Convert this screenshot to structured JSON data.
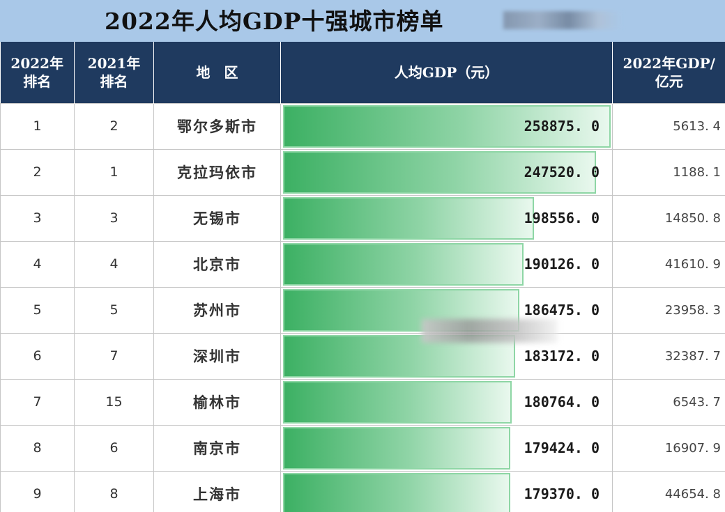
{
  "title": "2022年人均GDP十强城市榜单",
  "headers": {
    "rank_2022": [
      "2022年",
      "排名"
    ],
    "rank_2021": [
      "2021年",
      "排名"
    ],
    "region": "地　区",
    "gdp_per_capita": "人均GDP（元）",
    "gdp_total": [
      "2022年GDP/",
      "亿元"
    ]
  },
  "colors": {
    "header_bg": "#1f3a5f",
    "title_bg": "#a9c8e8",
    "bar_start": "#3cb063",
    "bar_end": "#e9f8ee"
  },
  "chart_data": {
    "type": "table",
    "bar_max": 258875.0,
    "rows": [
      {
        "rank_2022": "1",
        "rank_2021": "2",
        "city": "鄂尔多斯市",
        "gdp_per_capita": 258875.0,
        "gdp_per_capita_text": "258875. 0",
        "gdp_total": "5613. 4"
      },
      {
        "rank_2022": "2",
        "rank_2021": "1",
        "city": "克拉玛依市",
        "gdp_per_capita": 247520.0,
        "gdp_per_capita_text": "247520. 0",
        "gdp_total": "1188. 1"
      },
      {
        "rank_2022": "3",
        "rank_2021": "3",
        "city": "无锡市",
        "gdp_per_capita": 198556.0,
        "gdp_per_capita_text": "198556. 0",
        "gdp_total": "14850. 8"
      },
      {
        "rank_2022": "4",
        "rank_2021": "4",
        "city": "北京市",
        "gdp_per_capita": 190126.0,
        "gdp_per_capita_text": "190126. 0",
        "gdp_total": "41610. 9"
      },
      {
        "rank_2022": "5",
        "rank_2021": "5",
        "city": "苏州市",
        "gdp_per_capita": 186475.0,
        "gdp_per_capita_text": "186475. 0",
        "gdp_total": "23958. 3"
      },
      {
        "rank_2022": "6",
        "rank_2021": "7",
        "city": "深圳市",
        "gdp_per_capita": 183172.0,
        "gdp_per_capita_text": "183172. 0",
        "gdp_total": "32387. 7"
      },
      {
        "rank_2022": "7",
        "rank_2021": "15",
        "city": "榆林市",
        "gdp_per_capita": 180764.0,
        "gdp_per_capita_text": "180764. 0",
        "gdp_total": "6543. 7"
      },
      {
        "rank_2022": "8",
        "rank_2021": "6",
        "city": "南京市",
        "gdp_per_capita": 179424.0,
        "gdp_per_capita_text": "179424. 0",
        "gdp_total": "16907. 9"
      },
      {
        "rank_2022": "9",
        "rank_2021": "8",
        "city": "上海市",
        "gdp_per_capita": 179370.0,
        "gdp_per_capita_text": "179370. 0",
        "gdp_total": "44654. 8"
      }
    ]
  }
}
